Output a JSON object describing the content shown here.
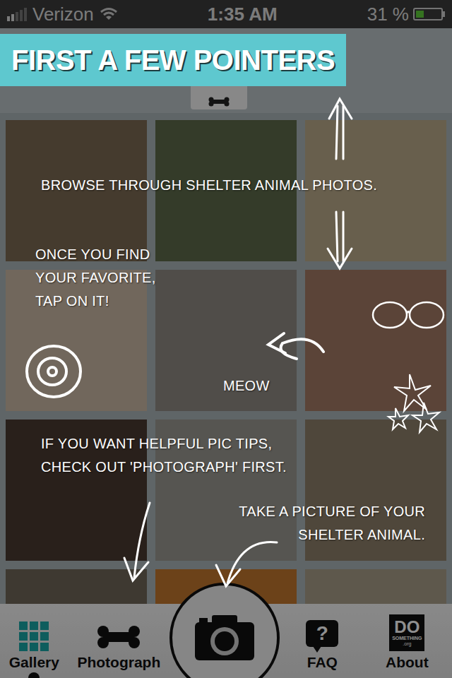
{
  "status_bar": {
    "carrier": "Verizon",
    "signal_bars": 2,
    "wifi": true,
    "time": "1:35 AM",
    "battery": "31 %",
    "battery_level": 0.31
  },
  "banner": {
    "title": "FIRST A FEW POINTERS"
  },
  "annotations": [
    {
      "lines": [
        "BROWSE THROUGH SHELTER ANIMAL PHOTOS."
      ]
    },
    {
      "lines": [
        "ONCE YOU FIND",
        "YOUR FAVORITE,",
        "TAP ON IT!"
      ]
    },
    {
      "lines": [
        "MEOW"
      ]
    },
    {
      "lines": [
        "IF YOU WANT HELPFUL PIC TIPS,",
        "CHECK OUT 'PHOTOGRAPH' FIRST."
      ]
    },
    {
      "lines": [
        "TAKE A PICTURE OF YOUR",
        "SHELTER ANIMAL."
      ]
    }
  ],
  "tabs": [
    {
      "kind": "grid",
      "label": "Gallery",
      "selected": true
    },
    {
      "kind": "bone",
      "label": "Photograph",
      "selected": false
    },
    {
      "kind": "camera",
      "label": "",
      "selected": false
    },
    {
      "kind": "faq",
      "label": "FAQ",
      "glyph": "?",
      "selected": false
    },
    {
      "kind": "logo",
      "label": "About",
      "logo": [
        "DO",
        "SOMETHING",
        ".org"
      ],
      "selected": false
    }
  ]
}
